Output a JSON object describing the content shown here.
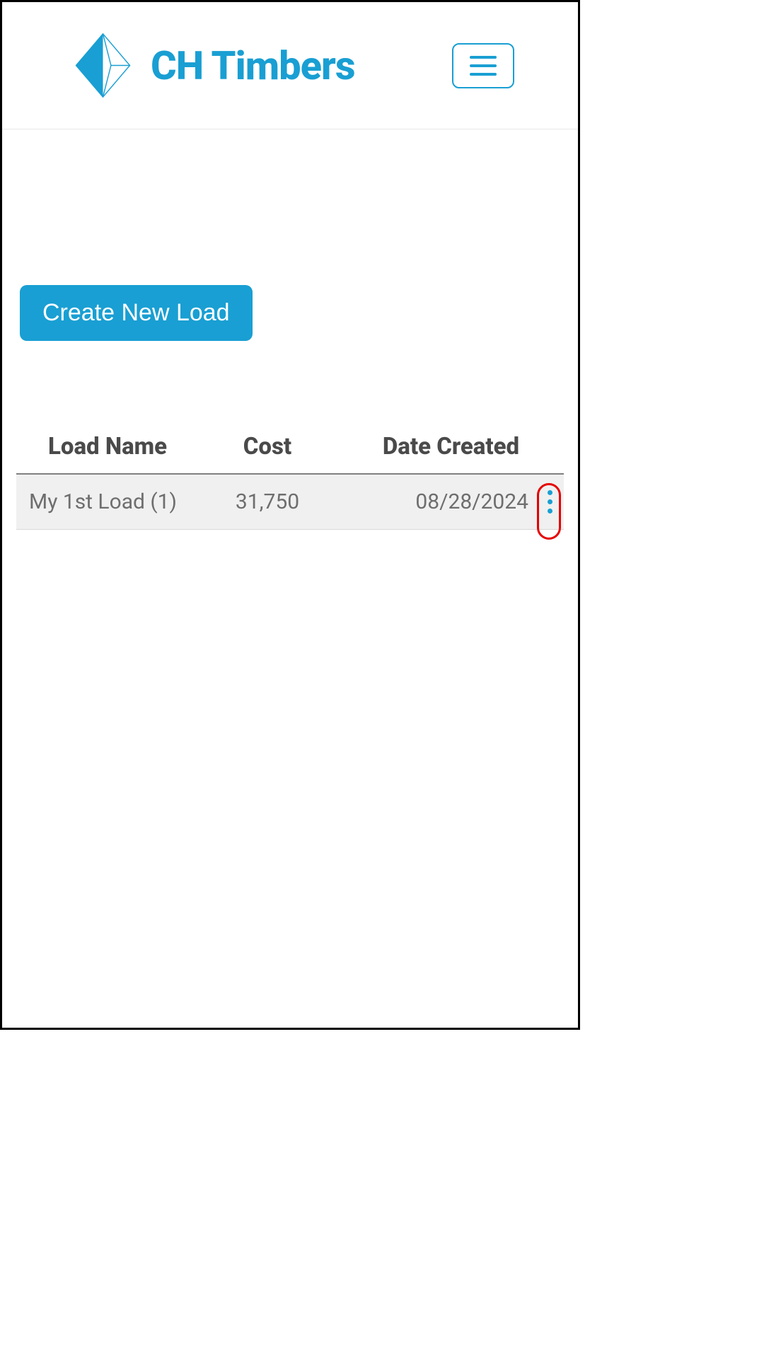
{
  "header": {
    "brand_text": "CH Timbers"
  },
  "actions": {
    "create_label": "Create New Load"
  },
  "table": {
    "headers": {
      "load_name": "Load Name",
      "cost": "Cost",
      "date_created": "Date Created"
    },
    "rows": [
      {
        "load_name": "My 1st Load (1)",
        "cost": "31,750",
        "date_created": "08/28/2024"
      }
    ]
  },
  "colors": {
    "accent": "#199FD3",
    "highlight": "#e60000"
  }
}
